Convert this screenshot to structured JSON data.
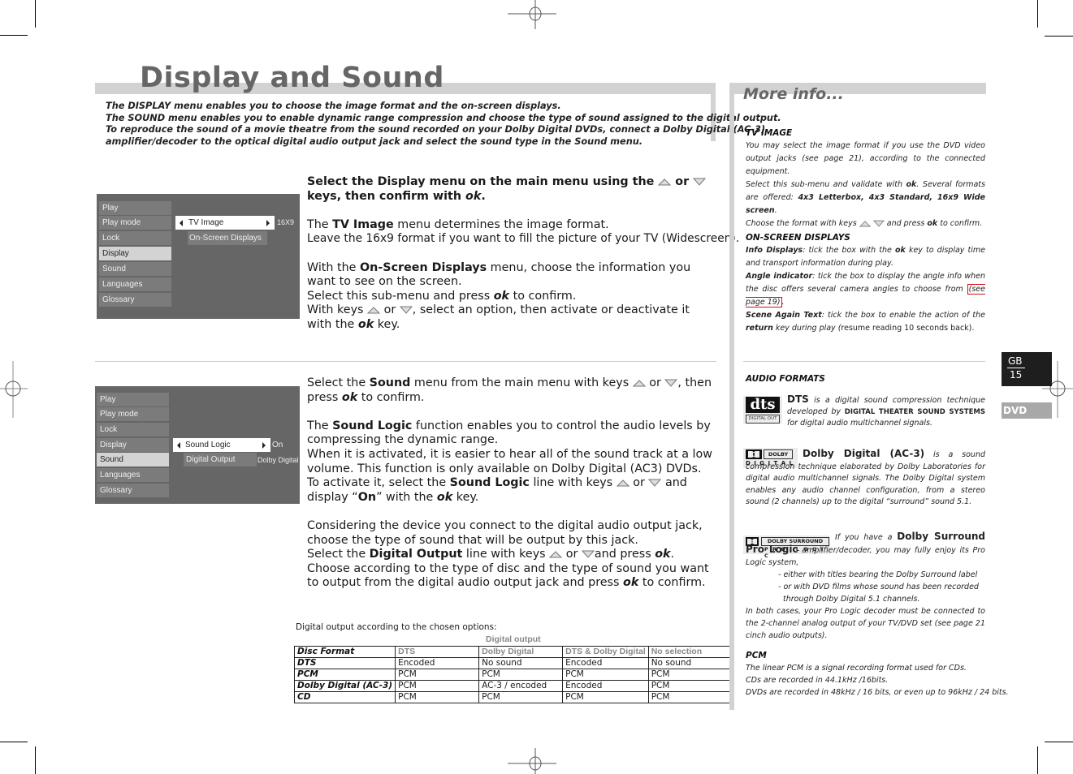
{
  "page": {
    "title": "Display and Sound",
    "intro": [
      "The DISPLAY menu enables you to choose the image format and the on-screen displays.",
      "The SOUND menu enables you to enable dynamic range compression and choose the type of sound assigned to the digital output.",
      "To reproduce the sound of a movie theatre from the sound recorded on your Dolby Digital DVDs, connect a Dolby Digital (AC-3)",
      "amplifier/decoder to the optical digital audio output jack and select the sound type in the Sound menu."
    ]
  },
  "display_menu": {
    "items": [
      "Play",
      "Play mode",
      "Lock",
      "Display",
      "Sound",
      "Languages",
      "Glossary"
    ],
    "selected": "Display",
    "sub_items": [
      {
        "label": "TV Image",
        "value": "16X9",
        "active": true
      },
      {
        "label": "On-Screen Displays",
        "value": "",
        "active": false
      }
    ]
  },
  "sound_menu": {
    "items": [
      "Play",
      "Play mode",
      "Lock",
      "Display",
      "Sound",
      "Languages",
      "Glossary"
    ],
    "selected": "Sound",
    "sub_items": [
      {
        "label": "Sound Logic",
        "value": "On",
        "active": true
      },
      {
        "label": "Digital Output",
        "value": "Dolby Digital",
        "active": false
      }
    ]
  },
  "display_text": {
    "l1a": "Select the ",
    "l1b": "Display",
    "l1c": " menu on the main menu using the ",
    "or": " or ",
    "l2a": "keys, then confirm with ",
    "l2b": "ok",
    "l2c": ".",
    "p2a": "The ",
    "p2b": "TV Image",
    "p2c": " menu determines the image format.",
    "p2d": "Leave the 16x9 format if you want to fill the picture of your TV (Widescreen).",
    "p3a": "With the ",
    "p3b": "On-Screen Displays",
    "p3c": " menu, choose the information you want to see on the screen.",
    "p3d": "Select this sub-menu and press ",
    "p3e": "ok",
    "p3f": " to confirm.",
    "p3g": "With keys ",
    "p3h": ", select an option, then activate or deactivate it with the ",
    "p3i": "ok",
    "p3j": " key."
  },
  "sound_text": {
    "p1a": "Select the ",
    "p1b": "Sound",
    "p1c": " menu from the main menu with keys ",
    "or": " or ",
    "p1d": ", then press ",
    "p1e": "ok",
    "p1f": " to confirm.",
    "p2a": "The ",
    "p2b": "Sound Logic",
    "p2c": " function enables you to control the audio levels by compressing the dynamic range.",
    "p2d": "When it is activated, it is easier to hear all of the sound track at a low volume. This function is only available on Dolby Digital (AC3) DVDs.",
    "p2e": "To activate it, select the ",
    "p2f": "Sound Logic",
    "p2g": " line with keys ",
    "p2h": " and display “",
    "p2i": "On",
    "p2j": "” with the ",
    "p2k": "ok",
    "p2l": " key.",
    "p3a": "Considering the device you connect to the digital audio output jack, choose the type of sound that will be output by this jack.",
    "p3b": "Select the ",
    "p3c": "Digital Output",
    "p3d": " line with keys ",
    "p3e": "and press ",
    "p3f": "ok",
    "p3g": ".",
    "p3h": "Choose according to the type of disc and the type of sound you want to output from the digital audio output jack and press ",
    "p3i": "ok",
    "p3j": " to confirm."
  },
  "output_table": {
    "caption": "Digital output according to the chosen options:",
    "group_header": "Digital output",
    "columns": [
      "Disc Format",
      "DTS",
      "Dolby Digital",
      "DTS & Dolby Digital",
      "No selection"
    ],
    "rows": [
      [
        "DTS",
        "Encoded",
        "No sound",
        "Encoded",
        "No sound"
      ],
      [
        "PCM",
        "PCM",
        "PCM",
        "PCM",
        "PCM"
      ],
      [
        "Dolby Digital (AC-3)",
        "PCM",
        "AC-3 / encoded",
        "Encoded",
        "PCM"
      ],
      [
        "CD",
        "PCM",
        "PCM",
        "PCM",
        "PCM"
      ]
    ]
  },
  "more_info": {
    "title": "More info...",
    "tv_image": {
      "heading": "TV IMAGE",
      "t1": "You may select the image format if you use the DVD video output jacks (see page 21), according to the connected equipment.",
      "t2": "Select this sub-menu and validate with ",
      "t2b": "ok",
      "t2c": ". Several formats are offered: ",
      "formats": "4x3 Letterbox, 4x3 Standard, 16x9 Wide screen",
      "t2d": ".",
      "t3": "Choose the format with keys ",
      "t3b": " and press ",
      "t3c": "ok",
      "t3d": " to confirm."
    },
    "osd": {
      "heading": "ON-SCREEN DISPLAYS",
      "a1": "Info Displays",
      "a2": ": tick the box with the ",
      "a3": "ok",
      "a4": " key to display time and transport information during play.",
      "b1": "Angle indicator",
      "b2": ": tick the box to display the angle info when the disc offers several camera angles to choose from ",
      "b3": "(see page 19)",
      "b4": ".",
      "c1": "Scene Again Text",
      "c2": ": tick the box to enable the action of the ",
      "c3": "return",
      "c4": " key during play (",
      "c5": "resume reading 10 seconds back)."
    },
    "audio": {
      "heading": "AUDIO FORMATS",
      "dts_name": "DTS",
      "dts_t1": " is a digital sound compression technique developed by ",
      "dts_t2": "DIGITAL THEATER SOUND SYSTEMS",
      "dts_t3": " for digital audio multichannel signals.",
      "dts_logo": "dts",
      "dts_logo_sub": "DIGITAL OUT",
      "dd_name": "Dolby Digital (AC-3)",
      "dd_t1": " is a sound compression technique elaborated by Dolby Laboratories for digital audio multichannel signals. The Dolby Digital system enables any audio channel configuration, from a stereo sound (2 channels) up to the digital “surround” sound 5.1.",
      "dd_logo_top": "DOLBY",
      "dd_logo_bottom": "D I G I T A L",
      "pl_t0": "If you have a ",
      "pl_name": "Dolby Surround Pro Logic",
      "pl_t1": " amplifier/decoder, you may fully enjoy its Pro Logic system,",
      "pl_b1": "- either with titles bearing the Dolby Surround label",
      "pl_b2": "- or with DVD films whose sound has been recorded",
      "pl_b3": "through Dolby Digital 5.1 channels.",
      "pl_t2": "In both cases, your Pro Logic decoder must be connected to the 2-channel analog output of your TV/DVD set (see page 21  cinch audio outputs).",
      "pl_logo_top": "DOLBY SURROUND",
      "pl_logo_bottom": "P R O · L O G I C"
    },
    "pcm": {
      "heading": "PCM",
      "l1": "The linear PCM is a signal recording format used for CDs.",
      "l2": "CDs are recorded in 44.1kHz /16bits.",
      "l3": "DVDs are recorded in 48kHz / 16 bits, or even up to 96kHz / 24 bits."
    }
  },
  "side_tab": {
    "lang": "GB",
    "page": "15",
    "section": "DVD"
  }
}
